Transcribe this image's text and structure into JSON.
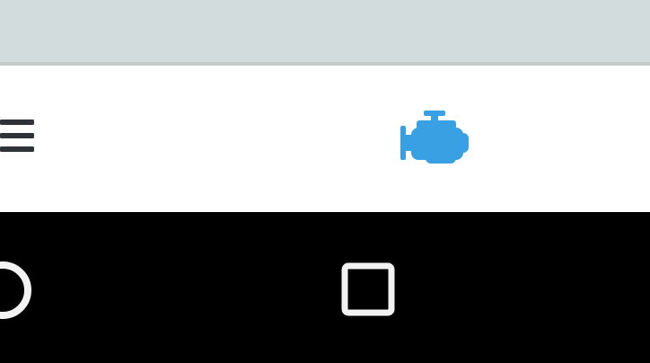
{
  "status_area": {
    "background": "#d3dcdc"
  },
  "app_bar": {
    "menu_icon": "hamburger-menu-icon",
    "logo_icon": "engine-icon",
    "accent_color": "#3aa0e4"
  },
  "navigation_bar": {
    "home_icon": "circle-home-icon",
    "recents_icon": "square-recents-icon"
  }
}
